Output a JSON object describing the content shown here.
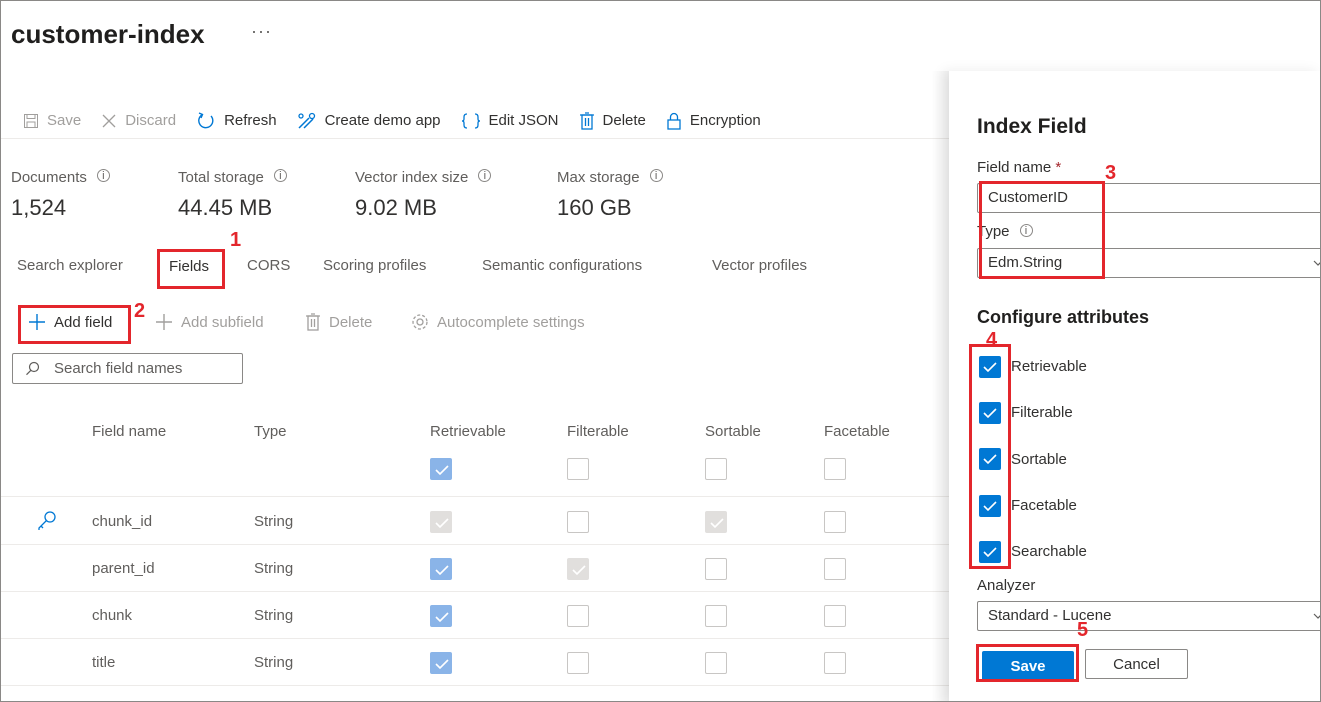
{
  "header": {
    "title": "customer-index",
    "more": "···"
  },
  "toolbar": {
    "save": "Save",
    "discard": "Discard",
    "refresh": "Refresh",
    "create_demo_app": "Create demo app",
    "edit_json": "Edit JSON",
    "delete": "Delete",
    "encryption": "Encryption"
  },
  "metrics": [
    {
      "label": "Documents",
      "value": "1,524"
    },
    {
      "label": "Total storage",
      "value": "44.45 MB"
    },
    {
      "label": "Vector index size",
      "value": "9.02 MB"
    },
    {
      "label": "Max storage",
      "value": "160 GB"
    }
  ],
  "tabs": [
    {
      "label": "Search explorer",
      "active": false
    },
    {
      "label": "Fields",
      "active": true
    },
    {
      "label": "CORS",
      "active": false
    },
    {
      "label": "Scoring profiles",
      "active": false
    },
    {
      "label": "Semantic configurations",
      "active": false
    },
    {
      "label": "Vector profiles",
      "active": false
    }
  ],
  "fields_toolbar": {
    "add_field": "Add field",
    "add_subfield": "Add subfield",
    "delete": "Delete",
    "autocomplete": "Autocomplete settings"
  },
  "search": {
    "placeholder": "Search field names"
  },
  "grid": {
    "columns": [
      "Field name",
      "Type",
      "Retrievable",
      "Filterable",
      "Sortable",
      "Facetable"
    ],
    "header_checks": {
      "retrievable": true,
      "filterable": false,
      "sortable": false,
      "facetable": false
    },
    "rows": [
      {
        "name": "chunk_id",
        "type": "String",
        "key": true,
        "retrievable": "gray",
        "filterable": "off",
        "sortable": "gray",
        "facetable": "off"
      },
      {
        "name": "parent_id",
        "type": "String",
        "key": false,
        "retrievable": "on",
        "filterable": "gray",
        "sortable": "off",
        "facetable": "off"
      },
      {
        "name": "chunk",
        "type": "String",
        "key": false,
        "retrievable": "on",
        "filterable": "off",
        "sortable": "off",
        "facetable": "off"
      },
      {
        "name": "title",
        "type": "String",
        "key": false,
        "retrievable": "on",
        "filterable": "off",
        "sortable": "off",
        "facetable": "off"
      }
    ]
  },
  "panel": {
    "title": "Index Field",
    "field_name_label": "Field name",
    "required_mark": "*",
    "field_name_value": "CustomerID",
    "type_label": "Type",
    "type_value": "Edm.String",
    "attributes_title": "Configure attributes",
    "attributes": [
      {
        "label": "Retrievable",
        "checked": true
      },
      {
        "label": "Filterable",
        "checked": true
      },
      {
        "label": "Sortable",
        "checked": true
      },
      {
        "label": "Facetable",
        "checked": true
      },
      {
        "label": "Searchable",
        "checked": true
      }
    ],
    "analyzer_label": "Analyzer",
    "analyzer_value": "Standard - Lucene",
    "save": "Save",
    "cancel": "Cancel"
  },
  "annotations": [
    "1",
    "2",
    "3",
    "4",
    "5"
  ],
  "colors": {
    "accent": "#0078d4",
    "annotation": "#e3262c",
    "check_light": "#8ab4e8"
  }
}
